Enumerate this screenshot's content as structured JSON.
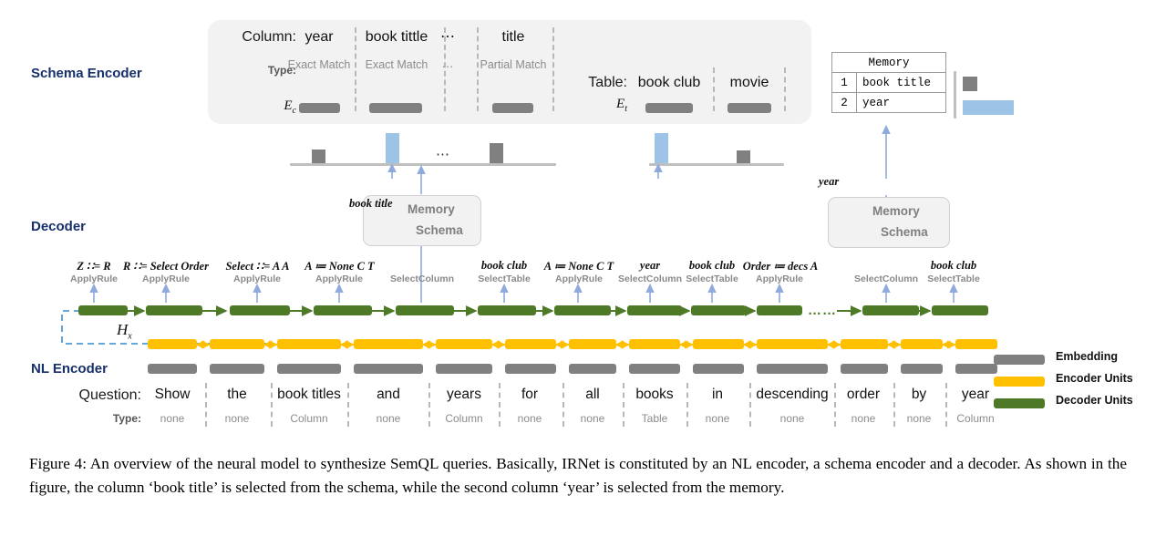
{
  "sections": {
    "schema_encoder": "Schema Encoder",
    "decoder": "Decoder",
    "nl_encoder": "NL Encoder"
  },
  "schema": {
    "column_label": "Column:",
    "type_label": "Type:",
    "embedding_col_symbol": "E",
    "embedding_col_sub": "c",
    "embedding_tab_symbol": "E",
    "embedding_tab_sub": "t",
    "table_label": "Table:",
    "columns": [
      {
        "name": "year",
        "type": "Exact Match",
        "attention": 0.34,
        "selected": false
      },
      {
        "name": "book tittle",
        "type": "Exact Match",
        "attention": 1.0,
        "selected": true
      },
      {
        "name": "⋯",
        "type": "⋯",
        "attention": 0.0,
        "selected": false
      },
      {
        "name": "title",
        "type": "Partial Match",
        "attention": 0.52,
        "selected": false
      }
    ],
    "tables": [
      {
        "name": "book club",
        "attention": 1.0,
        "selected": true
      },
      {
        "name": "movie",
        "attention": 0.34,
        "selected": false
      }
    ],
    "attention_ellipsis": "⋯"
  },
  "memory": {
    "title": "Memory",
    "rows": [
      {
        "index": "1",
        "value": "book title",
        "attention": 0.3,
        "selected": false
      },
      {
        "index": "2",
        "value": "year",
        "attention": 1.0,
        "selected": true
      }
    ]
  },
  "switches": [
    {
      "output": "book title",
      "memory_label": "Memory",
      "schema_label": "Schema",
      "position": "schema"
    },
    {
      "output": "year",
      "memory_label": "Memory",
      "schema_label": "Schema",
      "position": "memory"
    }
  ],
  "decoder": {
    "hidden_state_symbol": "H",
    "hidden_state_sub": "x",
    "gap_marker": "……",
    "steps": [
      {
        "rule": "Z ∷= R",
        "action": "ApplyRule"
      },
      {
        "rule": "R ∷= Select Order",
        "action": "ApplyRule"
      },
      {
        "rule": "Select ∷= A A",
        "action": "ApplyRule"
      },
      {
        "rule": "A ≔ None C T",
        "action": "ApplyRule"
      },
      {
        "rule": "",
        "action": "SelectColumn"
      },
      {
        "rule": "book club",
        "action": "SelectTable"
      },
      {
        "rule": "A ≔ None C T",
        "action": "ApplyRule"
      },
      {
        "rule": "year",
        "action": "SelectColumn"
      },
      {
        "rule": "book club",
        "action": "SelectTable"
      },
      {
        "rule": "Order ≔ decs A",
        "action": "ApplyRule"
      },
      {
        "rule": "",
        "action": "SelectColumn"
      },
      {
        "rule": "book club",
        "action": "SelectTable"
      }
    ]
  },
  "nl_encoder": {
    "question_label": "Question:",
    "type_label": "Type:",
    "tokens": [
      {
        "word": "Show",
        "type": "none"
      },
      {
        "word": "the",
        "type": "none"
      },
      {
        "word": "book titles",
        "type": "Column"
      },
      {
        "word": "and",
        "type": "none"
      },
      {
        "word": "years",
        "type": "Column"
      },
      {
        "word": "for",
        "type": "none"
      },
      {
        "word": "all",
        "type": "none"
      },
      {
        "word": "books",
        "type": "Table"
      },
      {
        "word": "in",
        "type": "none"
      },
      {
        "word": "descending",
        "type": "none"
      },
      {
        "word": "order",
        "type": "none"
      },
      {
        "word": "by",
        "type": "none"
      },
      {
        "word": "year",
        "type": "Column"
      }
    ]
  },
  "legend": [
    {
      "label": "Embedding",
      "color": "#808080"
    },
    {
      "label": "Encoder Units",
      "color": "#ffc000"
    },
    {
      "label": "Decoder Units",
      "color": "#4e7a27"
    }
  ],
  "caption": "Figure 4:   An overview of the neural model to synthesize SemQL queries.  Basically, IRNet is constituted by an NL encoder, a schema encoder and a decoder. As shown in the figure, the column ‘book title’ is selected from the schema, while the second column ‘year’ is selected from the memory.",
  "colors": {
    "selected_attention": "#9dc3e6",
    "unselected_attention": "#808080",
    "section_label": "#17306b",
    "arrow_blue": "#8faadc",
    "decoder_green": "#4e7a27",
    "encoder_yellow": "#ffc000"
  }
}
